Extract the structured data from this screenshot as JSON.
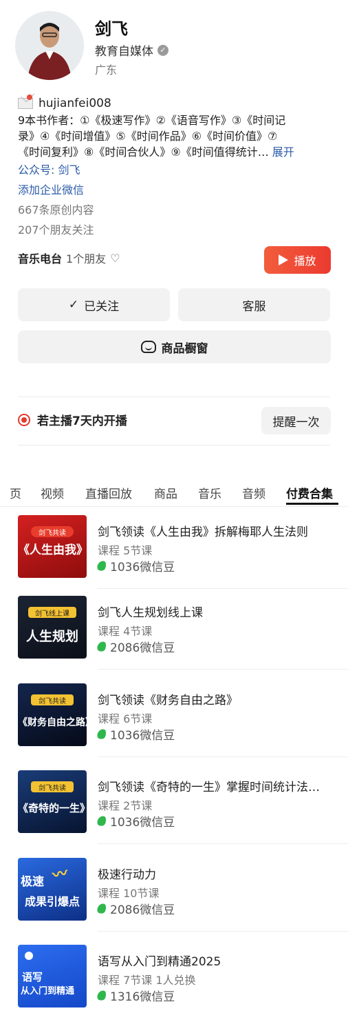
{
  "profile": {
    "name": "剑飞",
    "role": "教育自媒体",
    "region": "广东",
    "wechat_id": "hujianfei008",
    "bio_line1": "9本书作者：①《极速写作》②《语音写作》③《时间记",
    "bio_line2": "录》④《时间增值》⑤《时间作品》⑥《时间价值》⑦",
    "bio_line3": "《时间复利》⑧《时间合伙人》⑨《时间值得统计…",
    "expand": "展开",
    "official_account": "公众号: 剑飞",
    "enterprise_wechat": "添加企业微信",
    "original_count": "667条原创内容",
    "friends_follow": "207个朋友关注"
  },
  "music": {
    "title": "音乐电台",
    "friends": "1个朋友",
    "play_label": "播放"
  },
  "actions": {
    "followed": "已关注",
    "service": "客服",
    "shop": "商品橱窗"
  },
  "live": {
    "text": "若主播7天内开播",
    "remind": "提醒一次"
  },
  "tabs": [
    {
      "label": "页"
    },
    {
      "label": "视频"
    },
    {
      "label": "直播回放"
    },
    {
      "label": "商品"
    },
    {
      "label": "音乐"
    },
    {
      "label": "音频"
    },
    {
      "label": "付费合集"
    }
  ],
  "items": [
    {
      "title": "剑飞领读《人生由我》拆解梅耶人生法则",
      "meta": "课程 5节课",
      "price": "1036微信豆",
      "cover_tag": "剑飞共读",
      "cover_title": "《人生由我》",
      "cover_bg": "#c41a1a"
    },
    {
      "title": "剑飞人生规划线上课",
      "meta": "课程 4节课",
      "price": "2086微信豆",
      "cover_tag": "剑飞线上课",
      "cover_title": "人生规划",
      "cover_bg": "#141a26"
    },
    {
      "title": "剑飞领读《财务自由之路》",
      "meta": "课程 6节课",
      "price": "1036微信豆",
      "cover_tag": "剑飞共读",
      "cover_title": "《财务自由之路》",
      "cover_bg": "#0c1836"
    },
    {
      "title": "剑飞领读《奇特的一生》掌握时间统计法…",
      "meta": "课程 2节课",
      "price": "1036微信豆",
      "cover_tag": "剑飞共读",
      "cover_title": "《奇特的一生》",
      "cover_bg": "#0f2a56"
    },
    {
      "title": "极速行动力",
      "meta": "课程 10节课",
      "price": "2086微信豆",
      "cover_tag": "极速",
      "cover_title": "成果引爆点",
      "cover_bg": "#1a55c8"
    },
    {
      "title": "语写从入门到精通2025",
      "meta": "课程 7节课 1人兑换",
      "price": "1316微信豆",
      "cover_tag": "语写",
      "cover_title": "从入门到精通",
      "cover_bg": "#1f5fe0"
    }
  ]
}
